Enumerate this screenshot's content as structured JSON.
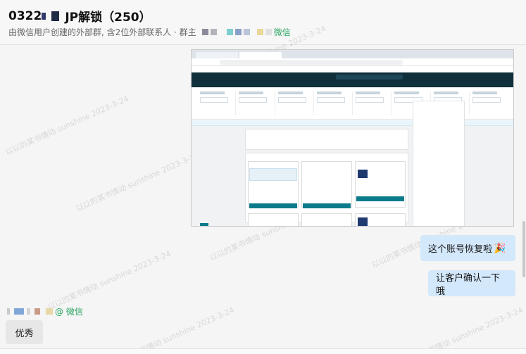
{
  "header": {
    "title_prefix": "0322",
    "title_suffix": "JP解锁（250）",
    "subtitle_prefix": "由微信用户创建的外部群, 含2位外部联系人 · 群主",
    "subtitle_tail": "微信"
  },
  "messages": {
    "msg1": "这个账号恢复啦",
    "msg1_emoji": "🎉",
    "msg2": "让客户确认一下哦",
    "sender_suffix": "@ 微信",
    "msg3": "优秀"
  },
  "watermark": "以以的某书情动 sunshine 2023-3-24",
  "colors": {
    "bubble_self": "#d4e8fb",
    "bubble_other": "#e7e7e7",
    "wechat_green": "#2aa564"
  }
}
